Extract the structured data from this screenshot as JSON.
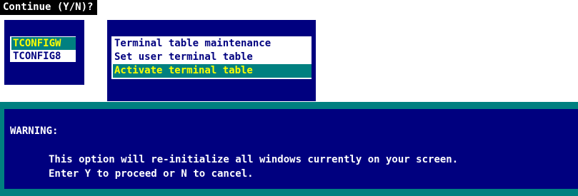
{
  "prompt": {
    "text": "Continue (Y/N)?"
  },
  "program_list": {
    "items": [
      {
        "label": "TCONFIGW",
        "selected": true
      },
      {
        "label": "TCONFIG8",
        "selected": false
      }
    ]
  },
  "menu": {
    "items": [
      {
        "label": "Terminal table maintenance",
        "selected": false
      },
      {
        "label": "Set user terminal table",
        "selected": false
      },
      {
        "label": "Activate terminal table",
        "selected": true
      }
    ]
  },
  "warning": {
    "title": "WARNING:",
    "lines": [
      "This option will re-initialize all windows currently on your screen.",
      "Enter Y to proceed or N to cancel."
    ]
  },
  "colors": {
    "window_bg": "#00007f",
    "highlight_bg": "#008080",
    "highlight_fg": "#ffff00",
    "list_bg": "#ffffff",
    "prompt_bg": "#000000"
  }
}
